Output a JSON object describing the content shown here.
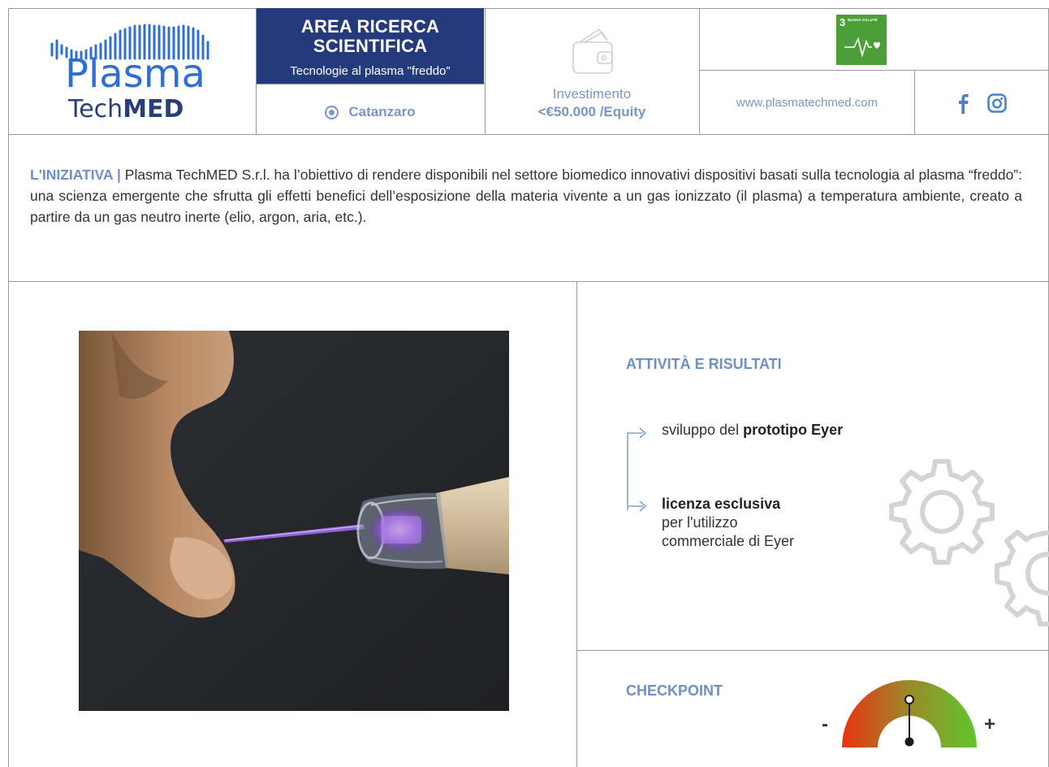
{
  "brand": {
    "logo_word_1": "Plasma",
    "logo_word_2a": "Tech",
    "logo_word_2b": "MED"
  },
  "header": {
    "area_title_line1": "AREA RICERCA",
    "area_title_line2": "SCIENTIFICA",
    "area_subtitle": "Tecnologie al plasma \"freddo\"",
    "location": "Catanzaro",
    "investment_label": "Investimento",
    "investment_value": "<€50.000 /Equity",
    "sdg_number": "3",
    "sdg_label": "BUONA SALUTE",
    "website": "www.plasmatechmed.com"
  },
  "intro": {
    "label": "L'INIZIATIVA |",
    "text": " Plasma TechMED S.r.l. ha l’obiettivo di rendere disponibili nel settore biomedico innovativi dispositivi basati sulla tecnologia al plasma “freddo”: una scienza emergente che sfrutta gli effetti benefici dell’esposizione della materia vivente a un gas ionizzato (il plasma) a temperatura ambiente, creato a partire da un gas neutro inerte (elio, argon, aria, etc.)."
  },
  "activities": {
    "title": "ATTIVITÀ E RISULTATI",
    "item1_normal": "sviluppo del ",
    "item1_bold": "prototipo Eyer",
    "item2_bold": "licenza esclusiva",
    "item2_line2": "per l'utilizzo",
    "item2_line3": "commerciale di Eyer"
  },
  "checkpoint": {
    "title": "CHECKPOINT",
    "minus": "-",
    "plus": "+",
    "level": 0.5
  },
  "colors": {
    "navy": "#233a7c",
    "accent_blue": "#6f8fc7",
    "sdg_green": "#4c9f38"
  },
  "icons": [
    "wallet-icon",
    "location-icon",
    "facebook-icon",
    "instagram-icon",
    "gear-icon",
    "arrow-right-icon"
  ]
}
